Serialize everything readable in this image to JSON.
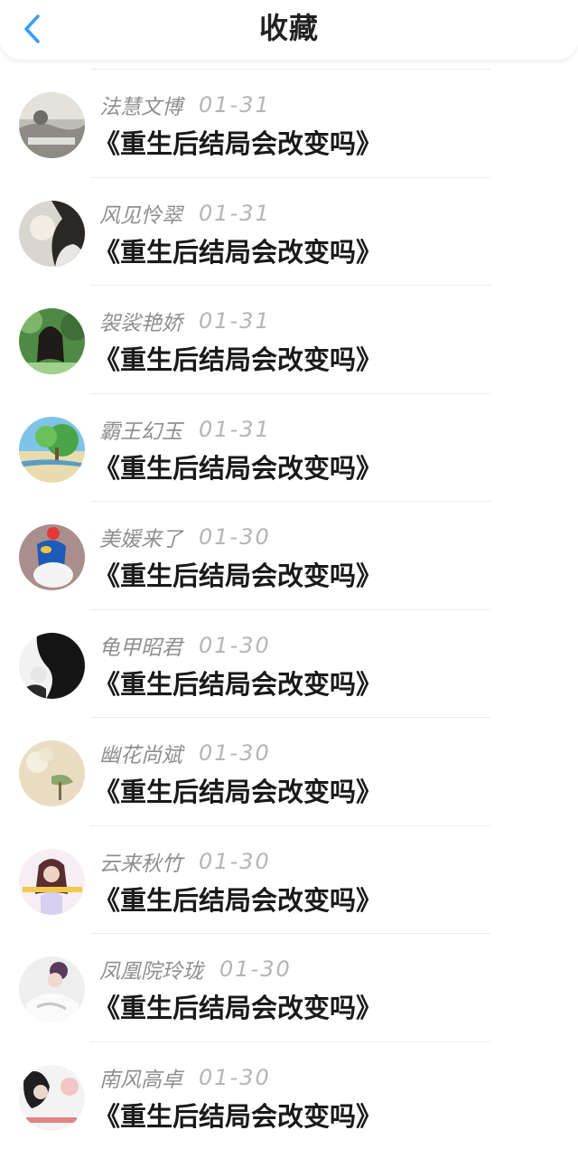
{
  "header": {
    "title": "收藏",
    "back_icon": "chevron-left-icon",
    "accent_color": "#3a9bff"
  },
  "items": [
    {
      "name": "法慧文博",
      "date": "01-31",
      "title": "《重生后结局会改变吗》"
    },
    {
      "name": "风见怜翠",
      "date": "01-31",
      "title": "《重生后结局会改变吗》"
    },
    {
      "name": "袈裟艳娇",
      "date": "01-31",
      "title": "《重生后结局会改变吗》"
    },
    {
      "name": "霸王幻玉",
      "date": "01-31",
      "title": "《重生后结局会改变吗》"
    },
    {
      "name": "美媛来了",
      "date": "01-30",
      "title": "《重生后结局会改变吗》"
    },
    {
      "name": "龟甲昭君",
      "date": "01-30",
      "title": "《重生后结局会改变吗》"
    },
    {
      "name": "幽花尚斌",
      "date": "01-30",
      "title": "《重生后结局会改变吗》"
    },
    {
      "name": "云来秋竹",
      "date": "01-30",
      "title": "《重生后结局会改变吗》"
    },
    {
      "name": "凤凰院玲珑",
      "date": "01-30",
      "title": "《重生后结局会改变吗》"
    },
    {
      "name": "南风高卓",
      "date": "01-30",
      "title": "《重生后结局会改变吗》"
    }
  ]
}
